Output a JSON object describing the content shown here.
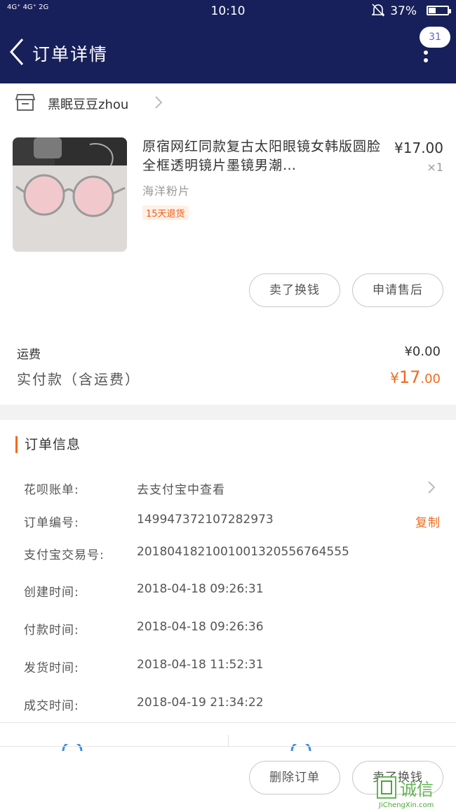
{
  "status_bar": {
    "signal_text": "4G⁺ 4G⁺ 2G",
    "time": "10:10",
    "battery_percent": "37%",
    "battery_level": 0.37
  },
  "header": {
    "title": "订单详情",
    "message_badge": "31"
  },
  "shop": {
    "name": "黑眠豆豆zhou"
  },
  "product": {
    "title": "原宿网红同款复古太阳眼镜女韩版圆脸全框透明镜片墨镜男潮…",
    "price": "¥17.00",
    "quantity": "×1",
    "variant": "海洋粉片",
    "return_tag": "15天退货"
  },
  "actions": {
    "sell_button": "卖了换钱",
    "after_sale_button": "申请售后"
  },
  "cost": {
    "shipping_label": "运费",
    "shipping_value": "¥0.00",
    "paid_label": "实付款（含运费）",
    "paid_currency": "¥",
    "paid_int": "17",
    "paid_dec": ".00"
  },
  "order_info": {
    "section_title": "订单信息",
    "huabei_label": "花呗账单:",
    "huabei_value": "去支付宝中查看",
    "order_no_label": "订单编号:",
    "order_no_value": "149947372107282973",
    "copy_label": "复制",
    "alipay_no_label": "支付宝交易号:",
    "alipay_no_value": "2018041821001001320556764555",
    "created_label": "创建时间:",
    "created_value": "2018-04-18 09:26:31",
    "paid_time_label": "付款时间:",
    "paid_time_value": "2018-04-18 09:26:36",
    "shipped_label": "发货时间:",
    "shipped_value": "2018-04-18 11:52:31",
    "deal_label": "成交时间:",
    "deal_value": "2018-04-19 21:34:22"
  },
  "bottom_bar": {
    "delete_button": "删除订单",
    "sell_button": "卖了换钱"
  },
  "watermark": {
    "text": "诚信",
    "url_text": "JiChengXin.com"
  }
}
